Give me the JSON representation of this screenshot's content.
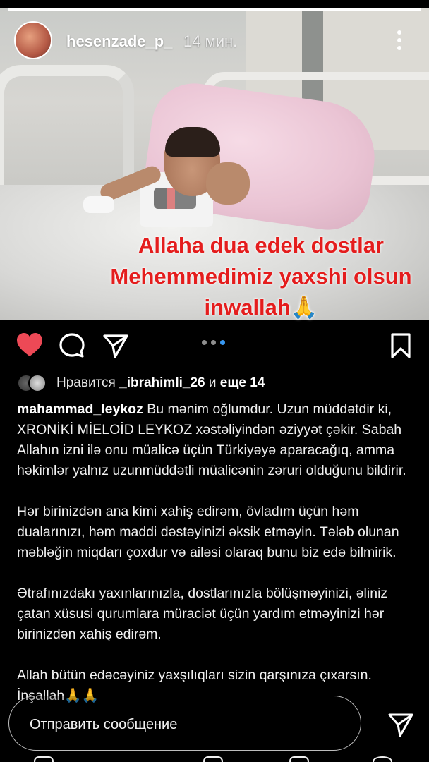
{
  "story": {
    "username": "hesenzade_p_",
    "time": "14 мин.",
    "overlay_lines": [
      "Allaha dua edek  dostlar",
      "Mehemmedimiz yaxshi olsun",
      "inwallah🙏"
    ],
    "progress": 1.0
  },
  "actions": {
    "like_icon": "heart-icon",
    "comment_icon": "comment-icon",
    "share_icon": "send-icon",
    "save_icon": "bookmark-icon",
    "carousel_dots": 3,
    "active_dot": 3,
    "like_color": "#ed4956",
    "active_dot_color": "#3897f0"
  },
  "likes": {
    "prefix": "Нравится",
    "user": "_ibrahimli_26",
    "mid": "и",
    "others": "еще 14"
  },
  "caption": {
    "user": "mahammad_leykoz",
    "paragraphs": [
      "Bu mənim oğlumdur. Uzun müddətdir ki, XRONİKİ MİELOİD LEYKOZ xəstəliyindən əziyyət çəkir. Sabah Allahın izni ilə onu müalicə üçün Türkiyəyə aparacağıq, amma həkimlər yalnız uzunmüddətli müalicənin zəruri olduğunu bildirir.",
      "Hər birinizdən ana kimi xahiş edirəm, övladım üçün həm dualarınızı, həm maddi dəstəyinizi əksik etməyin. Tələb olunan məbləğin miqdarı çoxdur və ailəsi olaraq bunu biz edə bilmirik.",
      "Ətrafınızdakı yaxınlarınızla, dostlarınızla bölüşməyinizi, əliniz çatan xüsusi qurumlara müraciət üçün yardım etməyinizi hər birinizdən xahiş edirəm.",
      "Allah bütün edəcəyiniz yaxşılıqları sizin qarşınıza çıxarsın. İnşallah🙏🙏"
    ]
  },
  "message": {
    "placeholder": "Отправить сообщение"
  }
}
